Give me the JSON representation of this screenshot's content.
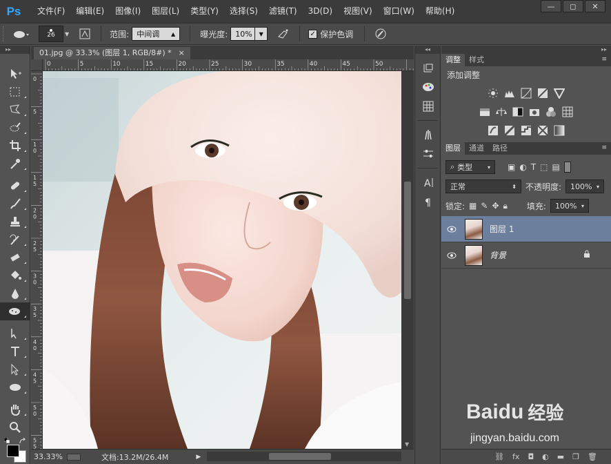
{
  "app": {
    "logo": "Ps"
  },
  "menu": [
    "文件(F)",
    "编辑(E)",
    "图像(I)",
    "图层(L)",
    "类型(Y)",
    "选择(S)",
    "滤镜(T)",
    "3D(D)",
    "视图(V)",
    "窗口(W)",
    "帮助(H)"
  ],
  "options": {
    "brush_size": "26",
    "range_label": "范围:",
    "range_value": "中间调",
    "exposure_label": "曝光度:",
    "exposure_value": "10%",
    "protect_label": "保护色调",
    "protect_checked": true
  },
  "document": {
    "tab_title": "01.jpg @ 33.3% (图层 1, RGB/8#) *",
    "ruler_h": [
      "0",
      "5",
      "10",
      "15",
      "20",
      "25",
      "30",
      "35",
      "40",
      "45",
      "50"
    ],
    "ruler_v": [
      "0",
      "5",
      "1\n0",
      "1\n5",
      "2\n0",
      "2\n5",
      "3\n0",
      "3\n5",
      "4\n0",
      "4\n5",
      "5\n0",
      "5\n5"
    ],
    "zoom": "33.33%",
    "doc_info": "文档:13.2M/26.4M"
  },
  "adjustments_panel": {
    "tabs": [
      "调整",
      "样式"
    ],
    "title": "添加调整"
  },
  "layers_panel": {
    "tabs": [
      "图层",
      "通道",
      "路径"
    ],
    "filter": "类型",
    "blend_mode": "正常",
    "opacity_label": "不透明度:",
    "opacity_value": "100%",
    "lock_label": "锁定:",
    "fill_label": "填充:",
    "fill_value": "100%",
    "layers": [
      {
        "name": "图层 1",
        "selected": true
      },
      {
        "name": "背景",
        "selected": false,
        "locked": true
      }
    ],
    "footer": [
      "fx"
    ]
  },
  "watermark": {
    "brand": "Baidu",
    "brand_cn": "经验",
    "url": "jingyan.baidu.com"
  },
  "colors": {
    "accent": "#31a8ff",
    "selected_layer": "#6c7f9c"
  }
}
